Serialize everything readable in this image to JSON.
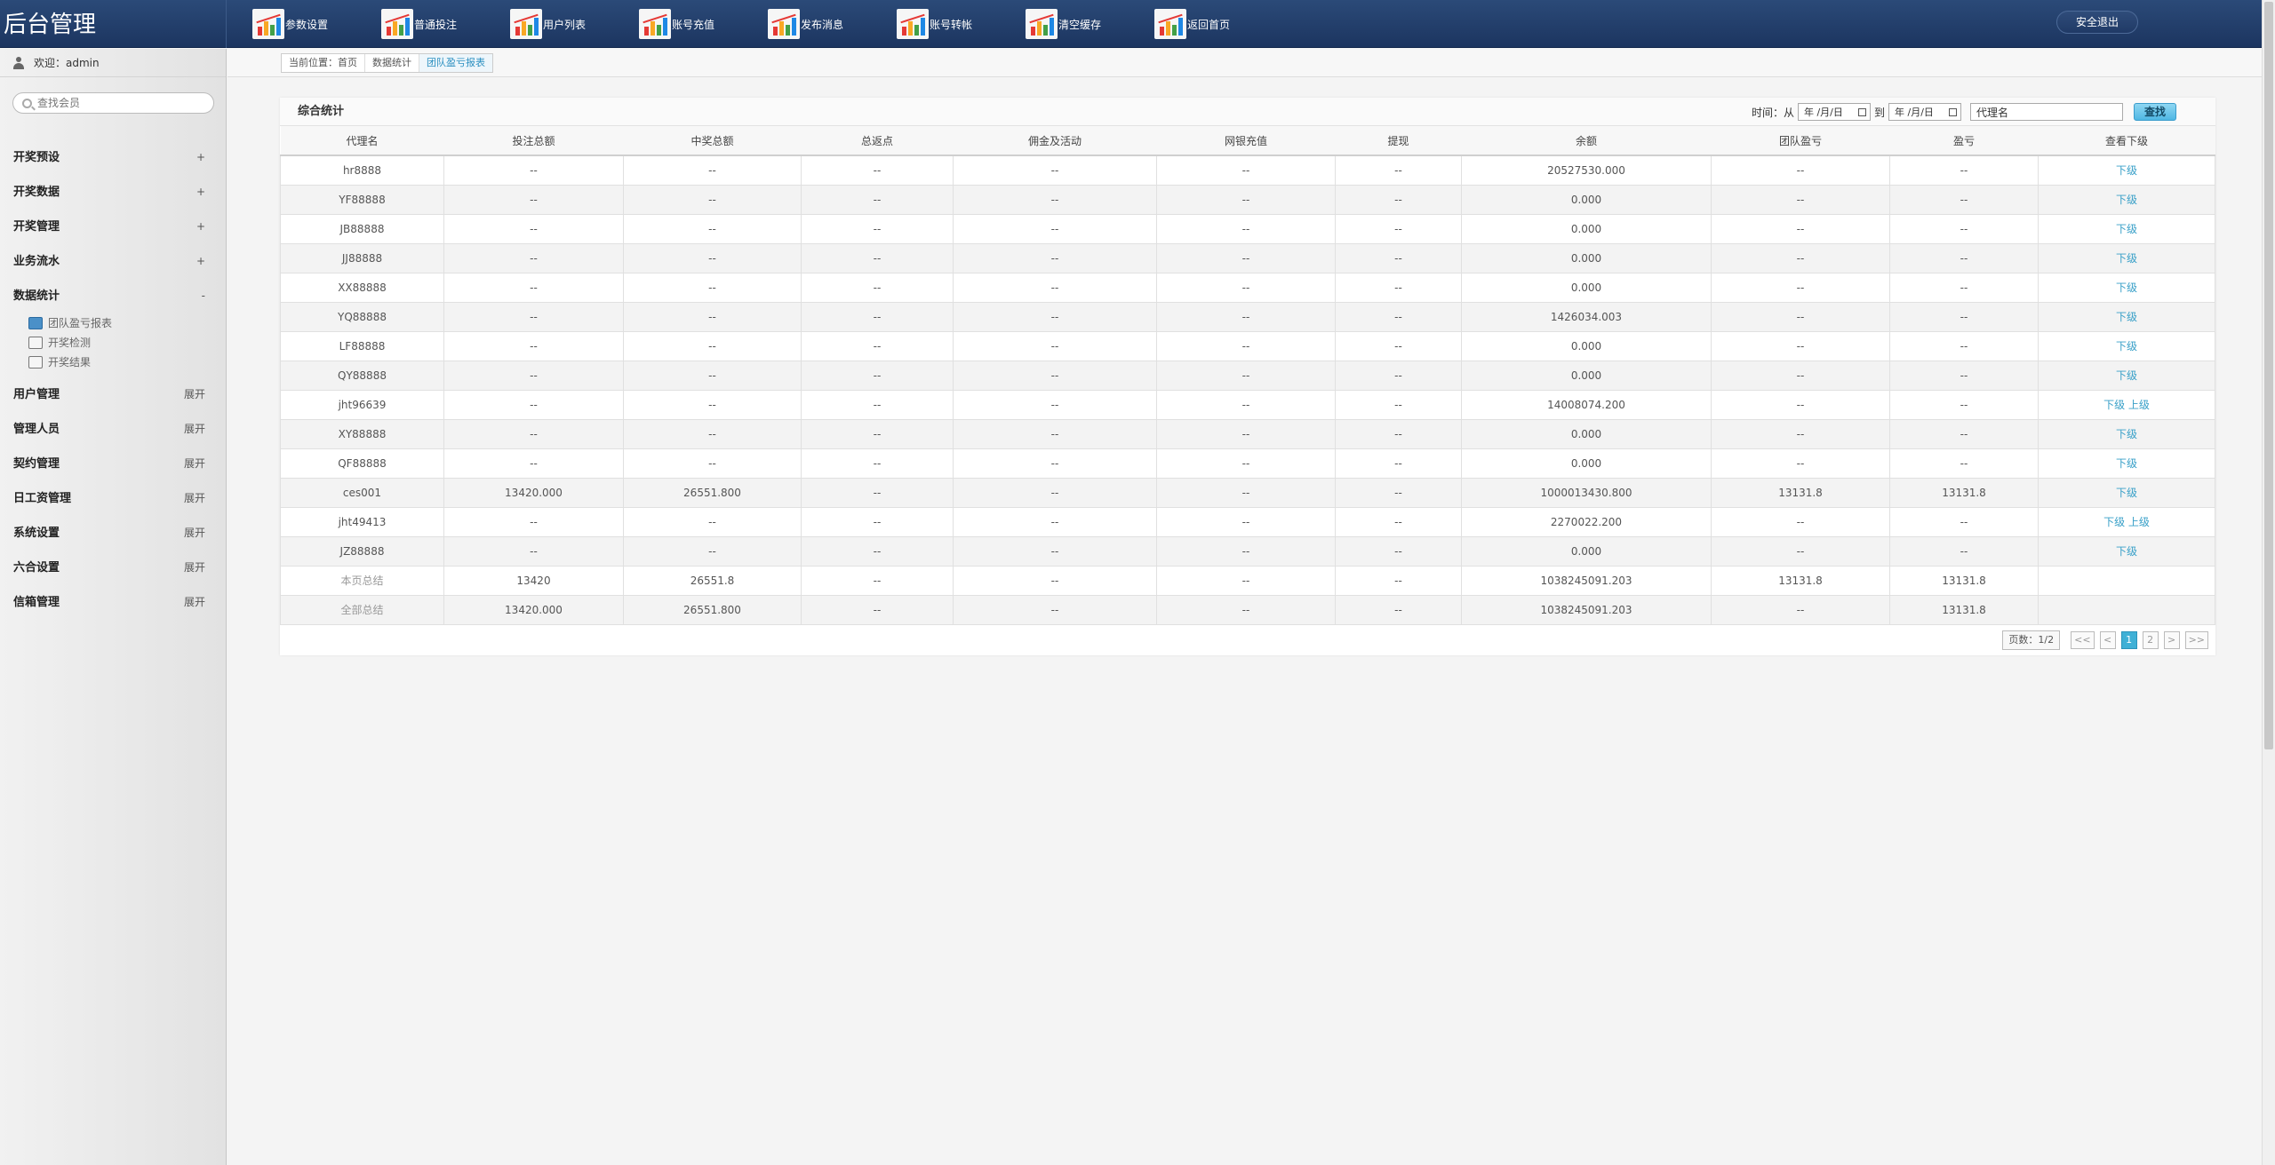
{
  "brand": "后台管理",
  "topnav": [
    "参数设置",
    "普通投注",
    "用户列表",
    "账号充值",
    "发布消息",
    "账号转帐",
    "清空缓存",
    "返回首页"
  ],
  "logout": "安全退出",
  "sidebar": {
    "user": "欢迎：admin",
    "search_placeholder": "查找会员",
    "groups": [
      {
        "label": "开奖预设",
        "toggle": "+"
      },
      {
        "label": "开奖数据",
        "toggle": "+"
      },
      {
        "label": "开奖管理",
        "toggle": "+"
      },
      {
        "label": "业务流水",
        "toggle": "+"
      },
      {
        "label": "数据统计",
        "toggle": "-"
      }
    ],
    "sub_items": [
      "团队盈亏报表",
      "开奖检测",
      "开奖结果"
    ],
    "groups2": [
      {
        "label": "用户管理",
        "toggle": "展开"
      },
      {
        "label": "管理人员",
        "toggle": "展开"
      },
      {
        "label": "契约管理",
        "toggle": "展开"
      },
      {
        "label": "日工资管理",
        "toggle": "展开"
      },
      {
        "label": "系统设置",
        "toggle": "展开"
      },
      {
        "label": "六合设置",
        "toggle": "展开"
      },
      {
        "label": "信箱管理",
        "toggle": "展开"
      }
    ]
  },
  "breadcrumb": [
    "当前位置：首页",
    "数据统计",
    "团队盈亏报表"
  ],
  "panel": {
    "title": "综合统计",
    "time_label": "时间：从",
    "to_label": "到",
    "date_placeholder": "年 /月/日",
    "name_value": "代理名",
    "search_btn": "查找"
  },
  "table": {
    "headers": [
      "代理名",
      "投注总额",
      "中奖总额",
      "总返点",
      "佣金及活动",
      "网银充值",
      "提现",
      "余额",
      "团队盈亏",
      "盈亏",
      "查看下级"
    ],
    "rows": [
      [
        "hr8888",
        "--",
        "--",
        "--",
        "--",
        "--",
        "--",
        "20527530.000",
        "--",
        "--",
        "下级",
        ""
      ],
      [
        "YF88888",
        "--",
        "--",
        "--",
        "--",
        "--",
        "--",
        "0.000",
        "--",
        "--",
        "下级",
        ""
      ],
      [
        "JB88888",
        "--",
        "--",
        "--",
        "--",
        "--",
        "--",
        "0.000",
        "--",
        "--",
        "下级",
        ""
      ],
      [
        "JJ88888",
        "--",
        "--",
        "--",
        "--",
        "--",
        "--",
        "0.000",
        "--",
        "--",
        "下级",
        ""
      ],
      [
        "XX88888",
        "--",
        "--",
        "--",
        "--",
        "--",
        "--",
        "0.000",
        "--",
        "--",
        "下级",
        ""
      ],
      [
        "YQ88888",
        "--",
        "--",
        "--",
        "--",
        "--",
        "--",
        "1426034.003",
        "--",
        "--",
        "下级",
        ""
      ],
      [
        "LF88888",
        "--",
        "--",
        "--",
        "--",
        "--",
        "--",
        "0.000",
        "--",
        "--",
        "下级",
        ""
      ],
      [
        "QY88888",
        "--",
        "--",
        "--",
        "--",
        "--",
        "--",
        "0.000",
        "--",
        "--",
        "下级",
        ""
      ],
      [
        "jht96639",
        "--",
        "--",
        "--",
        "--",
        "--",
        "--",
        "14008074.200",
        "--",
        "--",
        "下级",
        "上级"
      ],
      [
        "XY88888",
        "--",
        "--",
        "--",
        "--",
        "--",
        "--",
        "0.000",
        "--",
        "--",
        "下级",
        ""
      ],
      [
        "QF88888",
        "--",
        "--",
        "--",
        "--",
        "--",
        "--",
        "0.000",
        "--",
        "--",
        "下级",
        ""
      ],
      [
        "ces001",
        "13420.000",
        "26551.800",
        "--",
        "--",
        "--",
        "--",
        "1000013430.800",
        "13131.8",
        "13131.8",
        "下级",
        ""
      ],
      [
        "jht49413",
        "--",
        "--",
        "--",
        "--",
        "--",
        "--",
        "2270022.200",
        "--",
        "--",
        "下级",
        "上级"
      ],
      [
        "JZ88888",
        "--",
        "--",
        "--",
        "--",
        "--",
        "--",
        "0.000",
        "--",
        "--",
        "下级",
        ""
      ]
    ],
    "summary": [
      [
        "本页总结",
        "13420",
        "26551.8",
        "--",
        "--",
        "--",
        "--",
        "1038245091.203",
        "13131.8",
        "13131.8",
        ""
      ],
      [
        "全部总结",
        "13420.000",
        "26551.800",
        "--",
        "--",
        "--",
        "--",
        "1038245091.203",
        "--",
        "13131.8",
        ""
      ]
    ]
  },
  "pager": {
    "info": "页数：1/2",
    "first": "<<",
    "prev": "<",
    "pages": [
      "1",
      "2"
    ],
    "next": ">",
    "last": ">>"
  }
}
